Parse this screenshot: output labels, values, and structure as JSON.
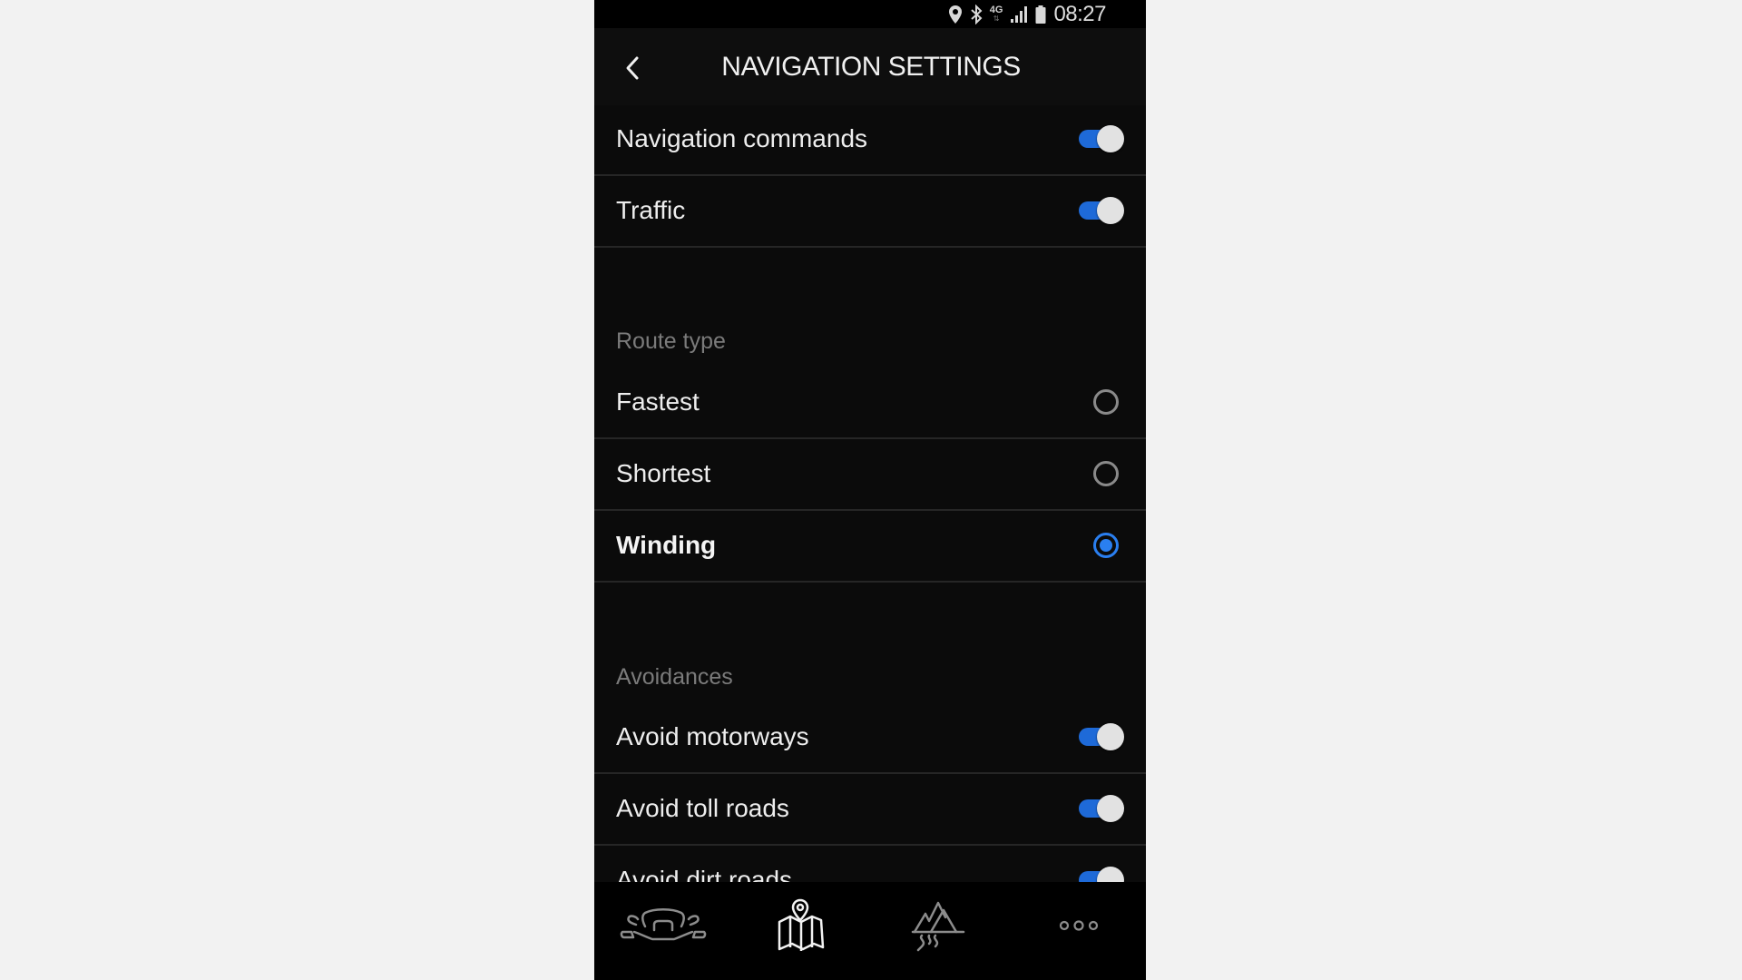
{
  "status_bar": {
    "network": "4G",
    "time": "08:27",
    "icons": [
      "location-icon",
      "bluetooth-icon",
      "network-4g-icon",
      "signal-icon",
      "battery-icon"
    ]
  },
  "header": {
    "title": "NAVIGATION SETTINGS",
    "back_icon": "chevron-left-icon"
  },
  "general": [
    {
      "label": "Navigation commands",
      "control": "toggle",
      "on": true
    },
    {
      "label": "Traffic",
      "control": "toggle",
      "on": true
    }
  ],
  "route_type": {
    "section_label": "Route type",
    "options": [
      {
        "label": "Fastest",
        "selected": false
      },
      {
        "label": "Shortest",
        "selected": false
      },
      {
        "label": "Winding",
        "selected": true
      }
    ]
  },
  "avoidances": {
    "section_label": "Avoidances",
    "items": [
      {
        "label": "Avoid motorways",
        "on": true
      },
      {
        "label": "Avoid toll roads",
        "on": true
      },
      {
        "label": "Avoid dirt roads",
        "on": true
      }
    ]
  },
  "bottom_nav": {
    "items": [
      {
        "icon": "motorcycle-icon",
        "active": false
      },
      {
        "icon": "map-pin-icon",
        "active": true
      },
      {
        "icon": "mountains-road-icon",
        "active": false
      },
      {
        "icon": "more-icon",
        "active": false
      }
    ]
  },
  "colors": {
    "accent": "#1e6ad8",
    "radio_selected": "#2a7ff0",
    "background": "#0b0b0b",
    "section_label": "#7b7b7b"
  }
}
